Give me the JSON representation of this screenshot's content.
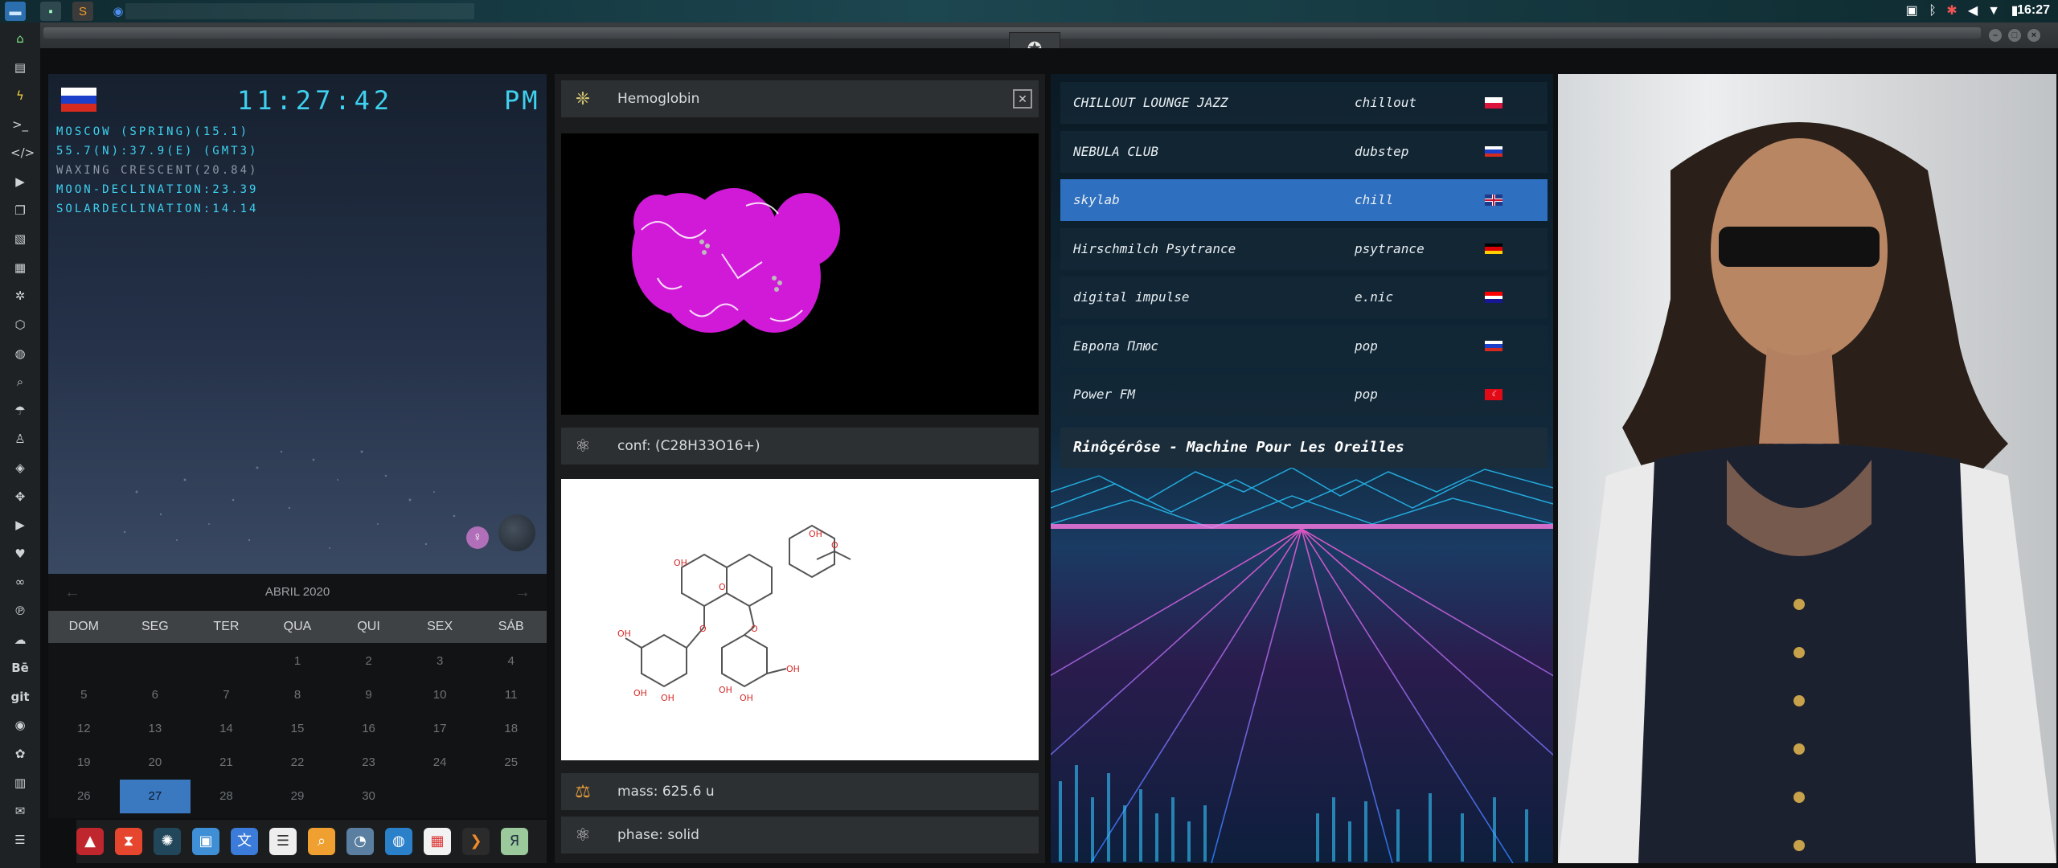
{
  "topbar": {
    "clock": "16:27",
    "apps": [
      "files-icon",
      "terminal-icon",
      "sublime-icon",
      "chrome-icon"
    ]
  },
  "dock_icons": [
    "home-icon",
    "document-icon",
    "bolt-icon",
    "terminal-icon",
    "code-icon",
    "play-icon",
    "copy-icon",
    "image-icon",
    "news-icon",
    "settings-icon",
    "hexagon-icon",
    "globe-icon",
    "search-icon",
    "umbrella-icon",
    "user-icon",
    "tag-icon",
    "expand-icon",
    "youtube-icon",
    "heart-icon",
    "link-icon",
    "pinterest-icon",
    "cloud-icon",
    "behance-icon",
    "git-icon",
    "github-icon",
    "bitbucket-icon",
    "map-icon",
    "mail-icon",
    "server-icon"
  ],
  "dock_text": {
    "behance": "Bē",
    "git": "git"
  },
  "clock_widget": {
    "time": "11:27:42",
    "ampm": "PM",
    "lines": [
      "MOSCOW (SPRING)(15.1)",
      "55.7(N):37.9(E) (GMT3)",
      "WAXING CRESCENT(20.84)",
      "MOON-DECLINATION:23.39",
      "SOLARDECLINATION:14.14"
    ]
  },
  "calendar": {
    "month": "ABRIL 2020",
    "weekdays": [
      "DOM",
      "SEG",
      "TER",
      "QUA",
      "QUI",
      "SEX",
      "SÁB"
    ],
    "days": [
      "",
      "",
      "",
      "1",
      "2",
      "3",
      "4",
      "5",
      "6",
      "7",
      "8",
      "9",
      "10",
      "11",
      "12",
      "13",
      "14",
      "15",
      "16",
      "17",
      "18",
      "19",
      "20",
      "21",
      "22",
      "23",
      "24",
      "25",
      "26",
      "27",
      "28",
      "29",
      "30",
      "",
      ""
    ],
    "today": "27"
  },
  "molecule": {
    "name": "Hemoglobin",
    "formula": "conf: (C28H33O16+)",
    "mass": "mass: 625.6 u",
    "phase": "phase: solid"
  },
  "radio": {
    "stations": [
      {
        "name": "CHILLOUT LOUNGE JAZZ",
        "genre": "chillout",
        "flag": "pl"
      },
      {
        "name": "NEBULA CLUB",
        "genre": "dubstep",
        "flag": "ru"
      },
      {
        "name": "skylab",
        "genre": "chill",
        "flag": "gb"
      },
      {
        "name": "Hirschmilch Psytrance",
        "genre": "psytrance",
        "flag": "de"
      },
      {
        "name": "digital impulse",
        "genre": "e.nic",
        "flag": "hr"
      },
      {
        "name": "Европа Плюс",
        "genre": "pop",
        "flag": "ru"
      },
      {
        "name": "Power FM",
        "genre": "pop",
        "flag": "tr"
      }
    ],
    "selected": "skylab",
    "now_playing": "Rinôçérôse - Machine Pour Les Oreilles"
  }
}
